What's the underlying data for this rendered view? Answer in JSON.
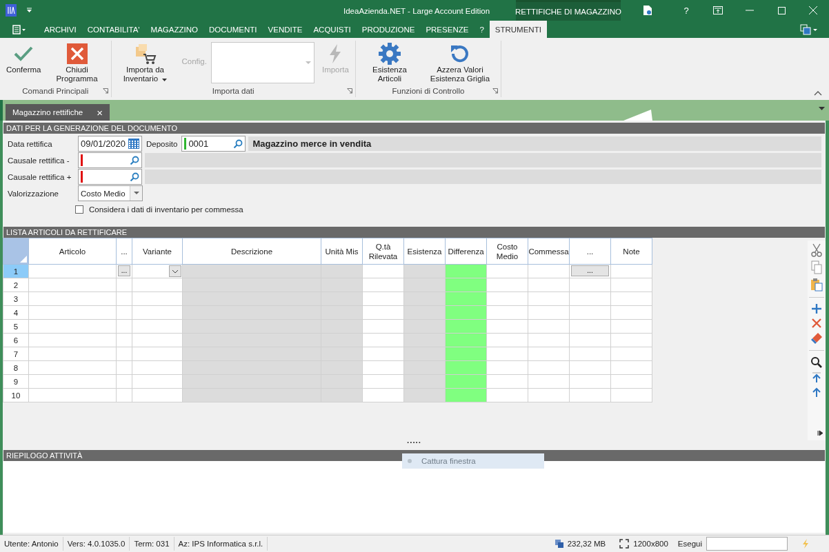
{
  "title_bar": {
    "title": "IdeaAzienda.NET - Large Account Edition",
    "context_tab": "RETTIFICHE DI MAGAZZINO",
    "help": "?"
  },
  "menu_tabs": [
    {
      "label": "ARCHIVI",
      "selected": false
    },
    {
      "label": "CONTABILITA'",
      "selected": false
    },
    {
      "label": "MAGAZZINO",
      "selected": false
    },
    {
      "label": "DOCUMENTI",
      "selected": false
    },
    {
      "label": "VENDITE",
      "selected": false
    },
    {
      "label": "ACQUISTI",
      "selected": false
    },
    {
      "label": "PRODUZIONE",
      "selected": false
    },
    {
      "label": "PRESENZE",
      "selected": false
    },
    {
      "label": "?",
      "selected": false
    },
    {
      "label": "STRUMENTI",
      "selected": true
    }
  ],
  "ribbon_groups": [
    {
      "label": "Comandi Principali",
      "buttons": [
        {
          "kind": "confirm",
          "label": "Conferma",
          "disabled": false,
          "dropdown": false
        },
        {
          "kind": "close",
          "label": "Chiudi Programma",
          "disabled": false,
          "dropdown": false
        }
      ]
    },
    {
      "label": "Importa dati",
      "buttons": [
        {
          "kind": "import",
          "label": "Importa da Inventario",
          "disabled": false,
          "dropdown": true
        },
        {
          "kind": "combo",
          "label": "Config.",
          "disabled": true
        },
        {
          "kind": "run",
          "label": "Importa",
          "disabled": true,
          "dropdown": false
        }
      ]
    },
    {
      "label": "Funzioni di Controllo",
      "buttons": [
        {
          "kind": "stock",
          "label": "Esistenza Articoli",
          "disabled": false,
          "dropdown": false
        },
        {
          "kind": "reset",
          "label": "Azzera Valori Esistenza Griglia",
          "disabled": false,
          "dropdown": false
        }
      ]
    }
  ],
  "document_tab": {
    "label": "Magazzino rettifiche",
    "close": "×"
  },
  "form_section": {
    "title": "DATI PER LA GENERAZIONE DEL DOCUMENTO",
    "date": {
      "label": "Data rettifica",
      "value": "09/01/2020"
    },
    "warehouse": {
      "label": "Deposito",
      "value": "0001",
      "valid": true,
      "description": "Magazzino merce in vendita"
    },
    "reasons": [
      {
        "label": "Causale rettifica -",
        "valid": false
      },
      {
        "label": "Causale rettifica +",
        "valid": false
      }
    ],
    "valuation": {
      "label": "Valorizzazione",
      "value": "Costo Medio"
    },
    "option": {
      "label": "Considera i dati di inventario per commessa",
      "checked": false
    }
  },
  "grid_section": {
    "title": "LISTA ARTICOLI DA RETTIFICARE",
    "columns": [
      {
        "label": "Articolo",
        "kind": "editable"
      },
      {
        "label": "...",
        "kind": "editable",
        "editor": {
          "kind": "button",
          "label": "..."
        }
      },
      {
        "label": "Variante",
        "kind": "editable",
        "editor": {
          "kind": "dropdown"
        }
      },
      {
        "label": "Descrizione",
        "kind": "readonly"
      },
      {
        "label": "Unità Mis",
        "kind": "readonly"
      },
      {
        "label": "Q.tà Rilevata",
        "kind": "editable"
      },
      {
        "label": "Esistenza",
        "kind": "readonly"
      },
      {
        "label": "Differenza",
        "kind": "highlight"
      },
      {
        "label": "Costo Medio",
        "kind": "editable"
      },
      {
        "label": "Commessa",
        "kind": "editable"
      },
      {
        "label": "...",
        "kind": "editable",
        "editor": {
          "kind": "button",
          "label": "..."
        }
      },
      {
        "label": "Note",
        "kind": "editable"
      }
    ],
    "rows": [
      {
        "label": "1",
        "selected": true
      },
      {
        "label": "2",
        "selected": false
      },
      {
        "label": "3",
        "selected": false
      },
      {
        "label": "4",
        "selected": false
      },
      {
        "label": "5",
        "selected": false
      },
      {
        "label": "6",
        "selected": false
      },
      {
        "label": "7",
        "selected": false
      },
      {
        "label": "8",
        "selected": false
      },
      {
        "label": "9",
        "selected": false
      },
      {
        "label": "10",
        "selected": false
      }
    ],
    "splitter": "....."
  },
  "summary_section": {
    "title": "RIEPILOGO ATTIVITÀ"
  },
  "overlay": {
    "label": "Cattura finestra"
  },
  "status_bar": {
    "items": [
      "Utente: Antonio",
      "Vers: 4.0.1035.0",
      "Term: 031",
      "Az: IPS Informatica s.r.l."
    ],
    "memory": "232,32 MB",
    "resolution": "1200x800",
    "run_label": "Esegui"
  }
}
